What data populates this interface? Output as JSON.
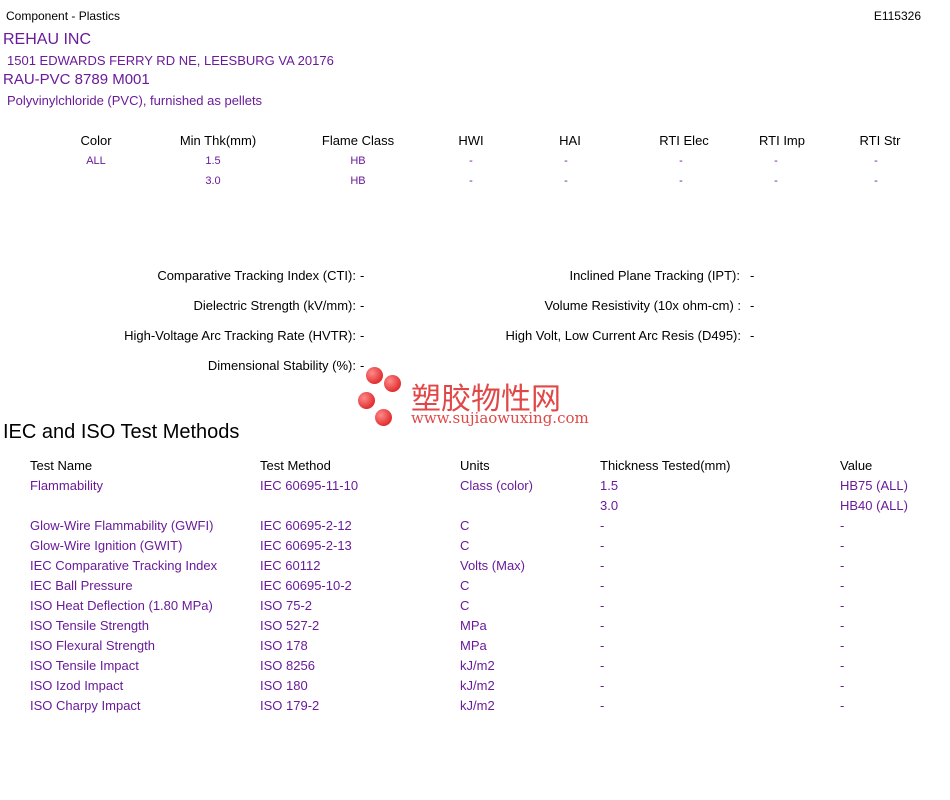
{
  "header": {
    "category": "Component - Plastics",
    "file_no": "E115326"
  },
  "company": {
    "name": "REHAU INC",
    "address": "1501 EDWARDS FERRY RD NE, LEESBURG VA   20176"
  },
  "product": {
    "name": "RAU-PVC 8789 M001",
    "description": "Polyvinylchloride (PVC), furnished as pellets"
  },
  "ratings": {
    "headers": [
      "Color",
      "Min Thk(mm)",
      "Flame Class",
      "HWI",
      "HAI",
      "RTI Elec",
      "RTI Imp",
      "RTI Str"
    ],
    "rows": [
      [
        "ALL",
        "1.5",
        "HB",
        "-",
        "-",
        "-",
        "-",
        "-"
      ],
      [
        "",
        "3.0",
        "HB",
        "-",
        "-",
        "-",
        "-",
        "-"
      ]
    ]
  },
  "properties": {
    "left": [
      {
        "label": "Comparative Tracking Index (CTI):",
        "value": "-"
      },
      {
        "label": "Dielectric Strength (kV/mm):",
        "value": "-"
      },
      {
        "label": "High-Voltage Arc Tracking Rate (HVTR):",
        "value": "-"
      },
      {
        "label": "Dimensional Stability (%):",
        "value": "-"
      }
    ],
    "right": [
      {
        "label": "Inclined Plane Tracking (IPT):",
        "value": "-"
      },
      {
        "label": "Volume Resistivity (10x ohm-cm) :",
        "value": "-"
      },
      {
        "label": "High Volt, Low Current Arc Resis (D495):",
        "value": "-"
      }
    ]
  },
  "watermark": {
    "cn": "塑胶物性网",
    "en": "www.sujiaowuxing.com",
    "color": "#e04848"
  },
  "test_methods": {
    "title": "IEC and ISO Test Methods",
    "headers": [
      "Test Name",
      "Test Method",
      "Units",
      "Thickness Tested(mm)",
      "Value"
    ],
    "rows": [
      [
        "Flammability",
        "IEC 60695-11-10",
        "Class (color)",
        "1.5",
        "HB75 (ALL)"
      ],
      [
        "",
        "",
        "",
        "3.0",
        "HB40 (ALL)"
      ],
      [
        "Glow-Wire Flammability (GWFI)",
        "IEC 60695-2-12",
        "C",
        "-",
        "-"
      ],
      [
        "Glow-Wire Ignition (GWIT)",
        "IEC 60695-2-13",
        "C",
        "-",
        "-"
      ],
      [
        "IEC Comparative Tracking Index",
        "IEC 60112",
        "Volts (Max)",
        "-",
        "-"
      ],
      [
        "IEC Ball Pressure",
        "IEC 60695-10-2",
        "C",
        "-",
        "-"
      ],
      [
        "ISO Heat Deflection (1.80 MPa)",
        "ISO 75-2",
        "C",
        "-",
        "-"
      ],
      [
        "ISO Tensile Strength",
        "ISO 527-2",
        "MPa",
        "-",
        "-"
      ],
      [
        "ISO Flexural Strength",
        "ISO 178",
        "MPa",
        "-",
        "-"
      ],
      [
        "ISO Tensile Impact",
        "ISO 8256",
        "kJ/m2",
        "-",
        "-"
      ],
      [
        "ISO Izod Impact",
        "ISO 180",
        "kJ/m2",
        "-",
        "-"
      ],
      [
        "ISO Charpy Impact",
        "ISO 179-2",
        "kJ/m2",
        "-",
        "-"
      ]
    ]
  },
  "colors": {
    "accent_purple": "#6a1b9a"
  }
}
